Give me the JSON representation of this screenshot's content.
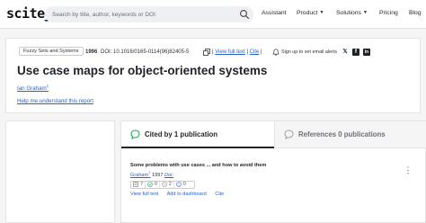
{
  "header": {
    "logo": "scite_",
    "search_placeholder": "Search by title, author, keywords or DOI",
    "nav": {
      "assistant": "Assistant",
      "product": "Product",
      "solutions": "Solutions",
      "pricing": "Pricing",
      "blog": "Blog"
    }
  },
  "paper": {
    "journal": "Fuzzy Sets and Systems",
    "year": "1996",
    "doi_label": "DOI:",
    "doi": "10.1016/0165-0114(96)82405-5",
    "view_full_text": "View full text",
    "cite": "Cite",
    "sign_up": "Sign up to set email alerts",
    "title": "Use case maps for object-oriented systems",
    "author": "Ian Graham",
    "author_sup": "1",
    "help_link": "Help me understand this report"
  },
  "tabs": {
    "cited_by": "Cited by 1 publication",
    "references": "References 0 publications"
  },
  "citation": {
    "title": "Some problems with use cases ... and how to avoid them",
    "author": "Graham",
    "author_sup": "1",
    "year": "1997",
    "doi": "Doi: ",
    "counts": {
      "mentioning": "7",
      "supporting": "0",
      "citing": "2",
      "contrasting": "0"
    },
    "actions": {
      "view": "View full text",
      "dashboard": "Add to dashboard",
      "cite": "Cite"
    }
  },
  "colors": {
    "link": "#2a63c5",
    "accent_green": "#18a058",
    "border": "#e4e4e7"
  }
}
